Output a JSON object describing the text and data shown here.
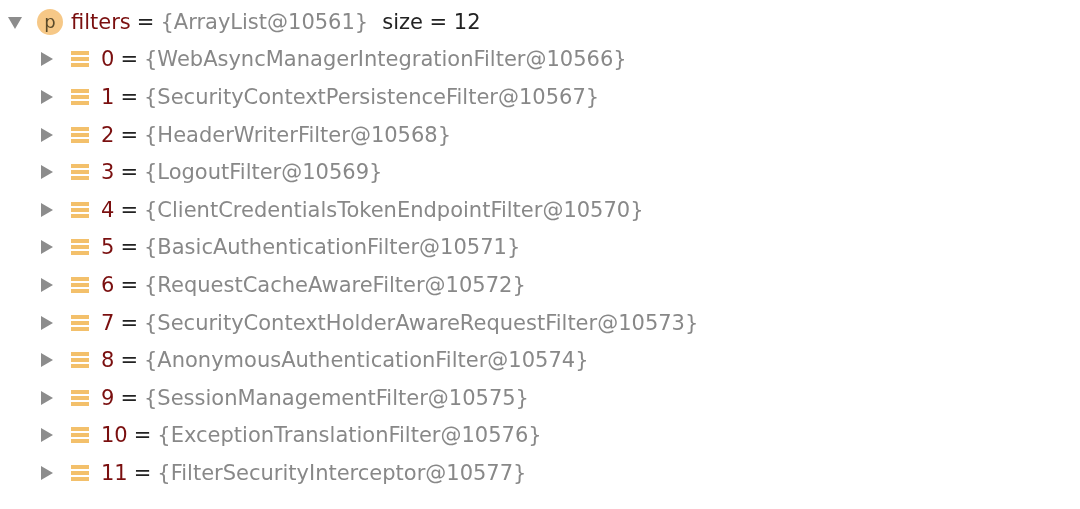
{
  "root": {
    "badge": "p",
    "name": "filters",
    "operator": "=",
    "value": "{ArrayList@10561}",
    "size": "size = 12",
    "expanded": true
  },
  "children": [
    {
      "name": "0",
      "operator": "=",
      "value": "{WebAsyncManagerIntegrationFilter@10566}",
      "expanded": false
    },
    {
      "name": "1",
      "operator": "=",
      "value": "{SecurityContextPersistenceFilter@10567}",
      "expanded": false
    },
    {
      "name": "2",
      "operator": "=",
      "value": "{HeaderWriterFilter@10568}",
      "expanded": false
    },
    {
      "name": "3",
      "operator": "=",
      "value": "{LogoutFilter@10569}",
      "expanded": false
    },
    {
      "name": "4",
      "operator": "=",
      "value": "{ClientCredentialsTokenEndpointFilter@10570}",
      "expanded": false
    },
    {
      "name": "5",
      "operator": "=",
      "value": "{BasicAuthenticationFilter@10571}",
      "expanded": false
    },
    {
      "name": "6",
      "operator": "=",
      "value": "{RequestCacheAwareFilter@10572}",
      "expanded": false
    },
    {
      "name": "7",
      "operator": "=",
      "value": "{SecurityContextHolderAwareRequestFilter@10573}",
      "expanded": false
    },
    {
      "name": "8",
      "operator": "=",
      "value": "{AnonymousAuthenticationFilter@10574}",
      "expanded": false
    },
    {
      "name": "9",
      "operator": "=",
      "value": "{SessionManagementFilter@10575}",
      "expanded": false
    },
    {
      "name": "10",
      "operator": "=",
      "value": "{ExceptionTranslationFilter@10576}",
      "expanded": false
    },
    {
      "name": "11",
      "operator": "=",
      "value": "{FilterSecurityInterceptor@10577}",
      "expanded": false
    }
  ]
}
